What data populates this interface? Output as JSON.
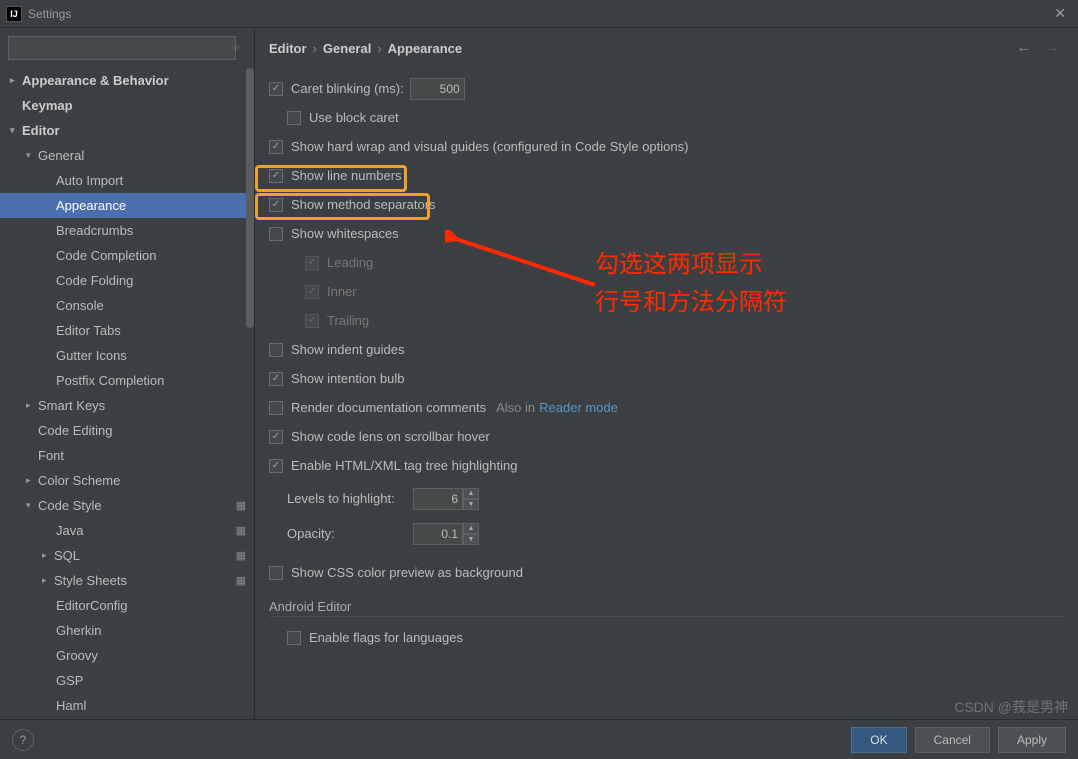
{
  "window": {
    "title": "Settings"
  },
  "search": {
    "placeholder": ""
  },
  "tree": {
    "appearance_behavior": "Appearance & Behavior",
    "keymap": "Keymap",
    "editor": "Editor",
    "general": "General",
    "auto_import": "Auto Import",
    "appearance": "Appearance",
    "breadcrumbs": "Breadcrumbs",
    "code_completion": "Code Completion",
    "code_folding": "Code Folding",
    "console": "Console",
    "editor_tabs": "Editor Tabs",
    "gutter_icons": "Gutter Icons",
    "postfix_completion": "Postfix Completion",
    "smart_keys": "Smart Keys",
    "code_editing": "Code Editing",
    "font": "Font",
    "color_scheme": "Color Scheme",
    "code_style": "Code Style",
    "java": "Java",
    "sql": "SQL",
    "style_sheets": "Style Sheets",
    "editorconfig": "EditorConfig",
    "gherkin": "Gherkin",
    "groovy": "Groovy",
    "gsp": "GSP",
    "haml": "Haml"
  },
  "breadcrumb": {
    "p1": "Editor",
    "p2": "General",
    "p3": "Appearance"
  },
  "opts": {
    "caret_blinking": "Caret blinking (ms):",
    "caret_blinking_val": "500",
    "use_block_caret": "Use block caret",
    "hard_wrap": "Show hard wrap and visual guides (configured in Code Style options)",
    "line_numbers": "Show line numbers",
    "method_separators": "Show method separators",
    "whitespaces": "Show whitespaces",
    "leading": "Leading",
    "inner": "Inner",
    "trailing": "Trailing",
    "indent_guides": "Show indent guides",
    "intention_bulb": "Show intention bulb",
    "render_doc": "Render documentation comments",
    "also_in": "Also in",
    "reader_mode": "Reader mode",
    "code_lens": "Show code lens on scrollbar hover",
    "tag_tree": "Enable HTML/XML tag tree highlighting",
    "levels_label": "Levels to highlight:",
    "levels_val": "6",
    "opacity_label": "Opacity:",
    "opacity_val": "0.1",
    "css_preview": "Show CSS color preview as background",
    "android_editor": "Android Editor",
    "enable_flags": "Enable flags for languages"
  },
  "annotation": {
    "line1": "勾选这两项显示",
    "line2": "行号和方法分隔符"
  },
  "footer": {
    "ok": "OK",
    "cancel": "Cancel",
    "apply": "Apply"
  },
  "watermark": "CSDN @莪是男神"
}
